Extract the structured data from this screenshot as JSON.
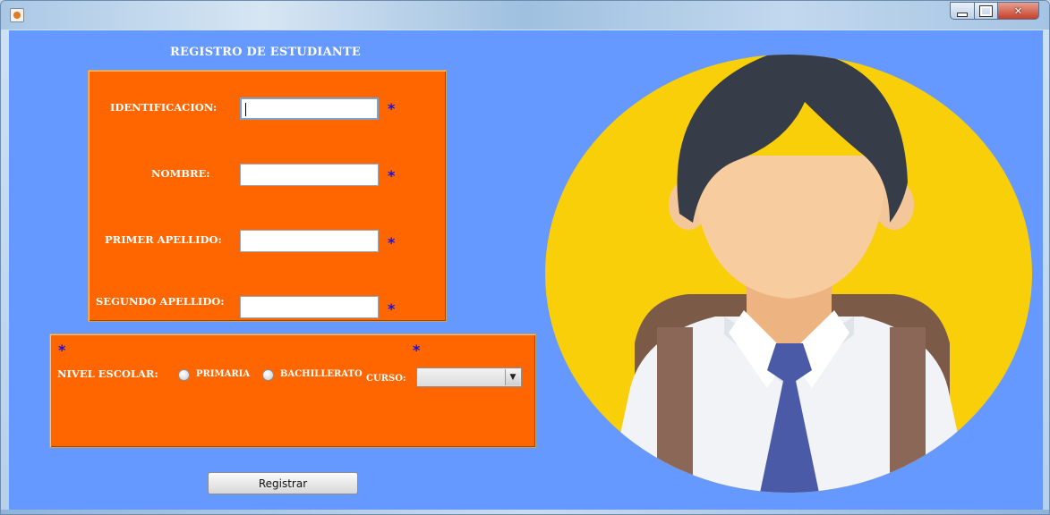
{
  "window": {
    "title": "",
    "controls": {
      "minimize": "minimize",
      "maximize": "maximize",
      "close": "close"
    }
  },
  "form": {
    "title": "REGISTRO DE ESTUDIANTE",
    "required_mark": "*",
    "fields": [
      {
        "label": "IDENTIFICACION:",
        "value": ""
      },
      {
        "label": "NOMBRE:",
        "value": ""
      },
      {
        "label": "PRIMER APELLIDO:",
        "value": ""
      },
      {
        "label": "SEGUNDO APELLIDO:",
        "value": ""
      }
    ],
    "nivel": {
      "label": "NIVEL ESCOLAR:",
      "options": [
        "PRIMARIA",
        "BACHILLERATO"
      ]
    },
    "curso": {
      "label": "CURSO:",
      "selected": ""
    },
    "submit_label": "Registrar"
  },
  "colors": {
    "background": "#6699ff",
    "panel": "#ff6600",
    "required": "#1111ee",
    "avatar_circle": "#f9cf0a"
  },
  "icons": [
    "java-app-icon",
    "minimize-icon",
    "maximize-icon",
    "close-icon",
    "dropdown-arrow-icon",
    "student-avatar-illustration"
  ]
}
